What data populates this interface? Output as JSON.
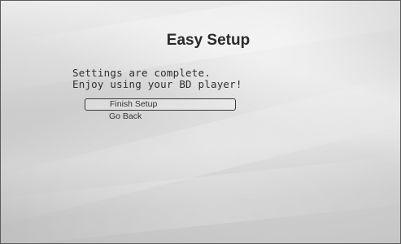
{
  "screen": {
    "title": "Easy Setup",
    "message": [
      "Settings are complete.",
      "Enjoy using your BD player!"
    ],
    "menu": [
      {
        "label": "Finish Setup",
        "selected": true
      },
      {
        "label": "Go Back",
        "selected": false
      }
    ]
  }
}
